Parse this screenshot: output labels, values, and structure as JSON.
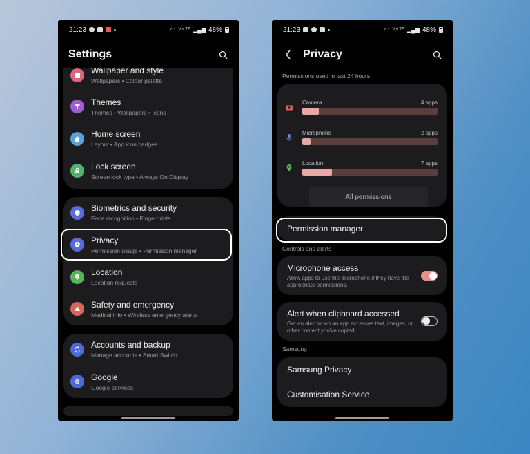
{
  "colors": {
    "accent_toggle": "#e7908b",
    "card_bg": "#1c1c1e",
    "bar_fill": "#e7a7a4",
    "bar_track": "#5a3e3e"
  },
  "status_bar": {
    "time_left": "21:23",
    "time_right": "21:23",
    "battery": "48%",
    "network": "VoLTE"
  },
  "settings": {
    "title": "Settings",
    "search_icon": "search-icon",
    "groups": [
      [
        {
          "id": "wallpaper",
          "title": "Wallpaper and style",
          "subtitle": "Wallpapers  •  Colour palette",
          "icon": "image-icon",
          "color": "#d8667d"
        },
        {
          "id": "themes",
          "title": "Themes",
          "subtitle": "Themes  •  Wallpapers  •  Icons",
          "icon": "theme-icon",
          "color": "#a35ad6"
        },
        {
          "id": "home",
          "title": "Home screen",
          "subtitle": "Layout  •  App icon badges",
          "icon": "home-icon",
          "color": "#5aa3d8"
        },
        {
          "id": "lock",
          "title": "Lock screen",
          "subtitle": "Screen lock type  •  Always On Display",
          "icon": "lock-icon",
          "color": "#4fb36a"
        }
      ],
      [
        {
          "id": "biometrics",
          "title": "Biometrics and security",
          "subtitle": "Face recognition  •  Fingerprints",
          "icon": "shield-icon",
          "color": "#5a6bd8"
        },
        {
          "id": "privacy",
          "title": "Privacy",
          "subtitle": "Permission usage  •  Permission manager",
          "icon": "privacy-shield-icon",
          "color": "#5a6bd8"
        },
        {
          "id": "location",
          "title": "Location",
          "subtitle": "Location requests",
          "icon": "location-pin-icon",
          "color": "#5bb35a"
        },
        {
          "id": "safety",
          "title": "Safety and emergency",
          "subtitle": "Medical info  •  Wireless emergency alerts",
          "icon": "emergency-icon",
          "color": "#d8665a"
        }
      ],
      [
        {
          "id": "accounts",
          "title": "Accounts and backup",
          "subtitle": "Manage accounts  •  Smart Switch",
          "icon": "sync-icon",
          "color": "#4f6ad8"
        },
        {
          "id": "google",
          "title": "Google",
          "subtitle": "Google services",
          "icon": "google-icon",
          "color": "#4f6ad8"
        }
      ]
    ]
  },
  "privacy": {
    "title": "Privacy",
    "back_icon": "back-arrow-icon",
    "search_icon": "search-icon",
    "usage_label": "Permissions used in last 24 hours",
    "usage": [
      {
        "id": "camera",
        "name": "Camera",
        "count": "4 apps",
        "fraction": 0.12,
        "icon": "camera-icon",
        "color": "#e0605a"
      },
      {
        "id": "microphone",
        "name": "Microphone",
        "count": "2 apps",
        "fraction": 0.06,
        "icon": "microphone-icon",
        "color": "#6b7be0"
      },
      {
        "id": "location",
        "name": "Location",
        "count": "7 apps",
        "fraction": 0.22,
        "icon": "location-pin-icon",
        "color": "#5bb35a"
      }
    ],
    "all_permissions": "All permissions",
    "permission_manager": "Permission manager",
    "controls_label": "Controls and alerts",
    "mic_access": {
      "title": "Microphone access",
      "subtitle": "Allow apps to use the microphone if they have the appropriate permissions.",
      "on": true
    },
    "clipboard": {
      "title": "Alert when clipboard accessed",
      "subtitle": "Get an alert when an app accesses text, images, or other content you've copied.",
      "on": false
    },
    "samsung_label": "Samsung",
    "samsung_items": [
      "Samsung Privacy",
      "Customisation Service"
    ]
  }
}
